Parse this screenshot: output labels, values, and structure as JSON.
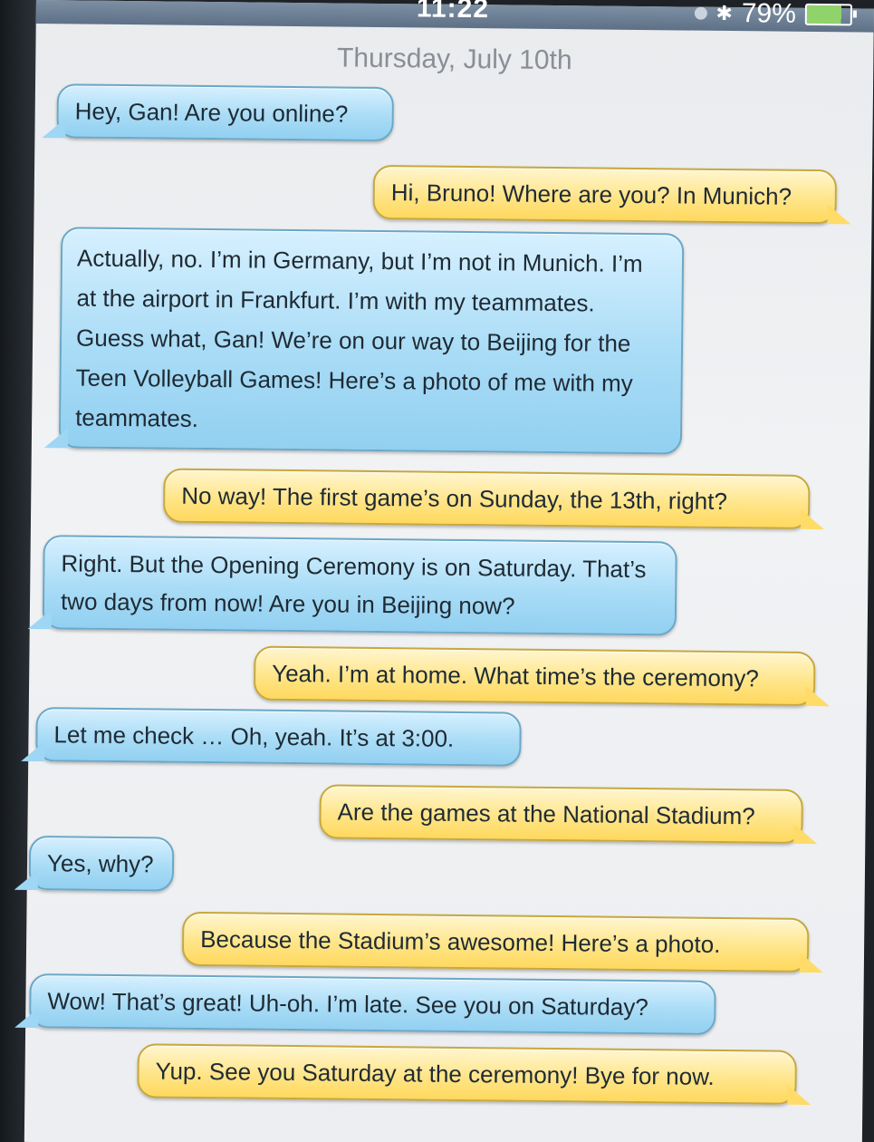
{
  "status_bar": {
    "time": "11:22",
    "battery": "79%"
  },
  "date_header": "Thursday, July 10th",
  "messages": [
    {
      "side": "in",
      "text": "Hey, Gan! Are you online?"
    },
    {
      "side": "out",
      "text": "Hi, Bruno! Where are you? In Munich?"
    },
    {
      "side": "in",
      "text": "Actually, no. I’m in Germany, but I’m not in Munich. I’m at the airport in Frankfurt. I’m with my teammates. Guess what, Gan! We’re on our way to Beijing for the Teen Volleyball Games! Here’s a photo of me with my teammates."
    },
    {
      "side": "out",
      "text": "No way! The first game’s on Sunday, the 13th, right?"
    },
    {
      "side": "in",
      "text": "Right. But the Opening Ceremony is on Saturday. That’s two days from now! Are you in Beijing now?"
    },
    {
      "side": "out",
      "text": "Yeah. I’m at home. What time’s the ceremony?"
    },
    {
      "side": "in",
      "text": "Let me check … Oh, yeah. It’s at 3:00."
    },
    {
      "side": "out",
      "text": "Are the games at the National Stadium?"
    },
    {
      "side": "in",
      "text": "Yes, why?"
    },
    {
      "side": "out",
      "text": "Because the Stadium’s awesome! Here’s a photo."
    },
    {
      "side": "in",
      "text": "Wow! That’s great! Uh-oh. I’m late. See you on Saturday?"
    },
    {
      "side": "out",
      "text": "Yup. See you Saturday at the ceremony! Bye for now."
    }
  ]
}
